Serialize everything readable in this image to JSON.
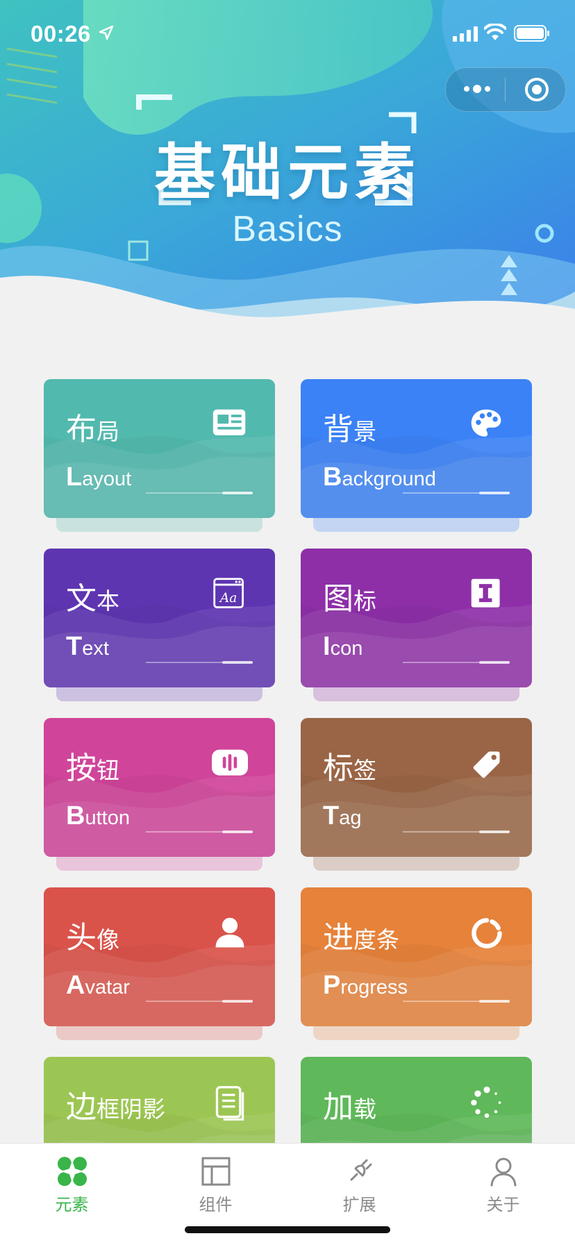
{
  "status_bar": {
    "time": "00:26"
  },
  "header": {
    "title": "基础元素",
    "subtitle": "Basics"
  },
  "colors": {
    "teal": "#52b9ae",
    "blue": "#3b82f6",
    "indigo": "#5e35b1",
    "purple": "#8e2fa8",
    "pink": "#d0449a",
    "brown": "#9a6546",
    "red": "#d9534a",
    "orange": "#e6823a",
    "olive": "#9cc653",
    "green": "#5fb85a",
    "tab_active": "#39b54a"
  },
  "cards": [
    {
      "cn_main": "布",
      "cn_rest": "局",
      "en_first": "L",
      "en_rest": "ayout",
      "icon": "layout-icon",
      "color": "#52b9ae"
    },
    {
      "cn_main": "背",
      "cn_rest": "景",
      "en_first": "B",
      "en_rest": "ackground",
      "icon": "palette-icon",
      "color": "#3b82f6"
    },
    {
      "cn_main": "文",
      "cn_rest": "本",
      "en_first": "T",
      "en_rest": "ext",
      "icon": "text-icon",
      "color": "#5e35b1"
    },
    {
      "cn_main": "图",
      "cn_rest": "标",
      "en_first": "I",
      "en_rest": "con",
      "icon": "icon-icon",
      "color": "#8e2fa8"
    },
    {
      "cn_main": "按",
      "cn_rest": "钮",
      "en_first": "B",
      "en_rest": "utton",
      "icon": "button-icon",
      "color": "#d0449a"
    },
    {
      "cn_main": "标",
      "cn_rest": "签",
      "en_first": "T",
      "en_rest": "ag",
      "icon": "tag-icon",
      "color": "#9a6546"
    },
    {
      "cn_main": "头",
      "cn_rest": "像",
      "en_first": "A",
      "en_rest": "vatar",
      "icon": "avatar-icon",
      "color": "#d9534a"
    },
    {
      "cn_main": "进",
      "cn_rest": "度条",
      "en_first": "P",
      "en_rest": "rogress",
      "icon": "progress-icon",
      "color": "#e6823a"
    },
    {
      "cn_main": "边",
      "cn_rest": "框阴影",
      "en_first": "",
      "en_rest": "",
      "icon": "document-icon",
      "color": "#9cc653"
    },
    {
      "cn_main": "加",
      "cn_rest": "载",
      "en_first": "",
      "en_rest": "",
      "icon": "loading-icon",
      "color": "#5fb85a"
    }
  ],
  "tabbar": {
    "tabs": [
      {
        "label": "元素",
        "icon": "elements-icon",
        "active": true
      },
      {
        "label": "组件",
        "icon": "components-icon",
        "active": false
      },
      {
        "label": "扩展",
        "icon": "plugin-icon",
        "active": false
      },
      {
        "label": "关于",
        "icon": "person-icon",
        "active": false
      }
    ]
  }
}
